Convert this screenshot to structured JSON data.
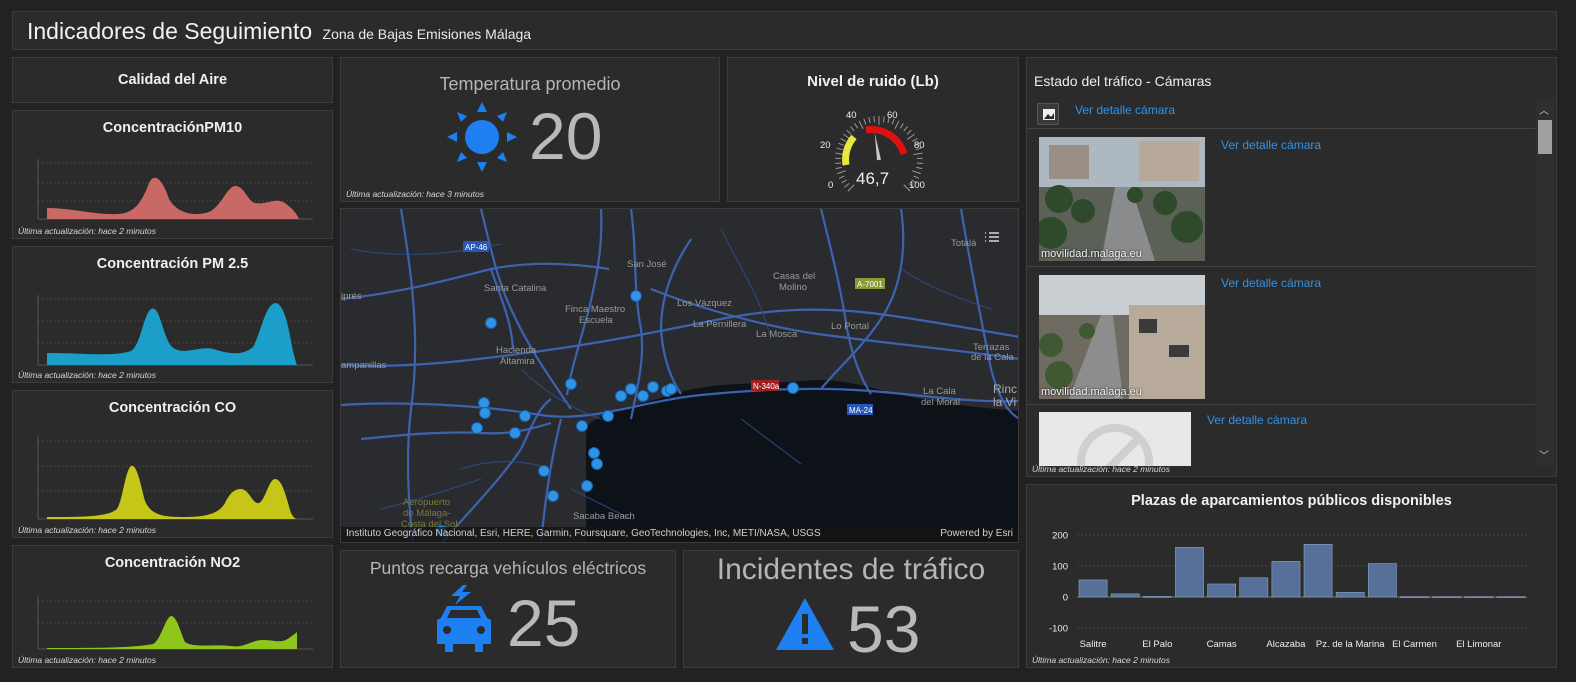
{
  "header": {
    "title": "Indicadores de Seguimiento",
    "subtitle": "Zona de Bajas Emisiones Málaga"
  },
  "air": {
    "title": "Calidad del Aire",
    "charts": [
      {
        "title": "ConcentraciónPM10",
        "updated": "Última actualización: hace 2 minutos",
        "color": "#c96966"
      },
      {
        "title": "Concentración PM 2.5",
        "updated": "Última actualización: hace 2 minutos",
        "color": "#1b9fc9"
      },
      {
        "title": "Concentración CO",
        "updated": "Última actualización: hace 2 minutos",
        "color": "#c6c618"
      },
      {
        "title": "Concentración NO2",
        "updated": "Última actualización: hace 2 minutos",
        "color": "#8ec61b"
      }
    ]
  },
  "temperature": {
    "title": "Temperatura promedio",
    "value": "20",
    "updated": "Última actualización: hace 3 minutos",
    "icon": "sun-icon"
  },
  "noise": {
    "title": "Nivel de ruido (Lb)",
    "value": "46,7",
    "reading": 46.7,
    "scale": [
      "0",
      "20",
      "40",
      "60",
      "80",
      "100"
    ]
  },
  "map": {
    "attribution": "Instituto Geográfico Nacional, Esri, HERE, Garmin, Foursquare, GeoTechnologies, Inc, METI/NASA, USGS",
    "powered": "Powered by Esri",
    "labels": {
      "ap46": "AP-46",
      "sanjose": "San José",
      "santacatalina": "Santa Catalina",
      "casas": "Casas del",
      "molino": "Molino",
      "a7001": "A-7001",
      "total": "Totalá",
      "finca": "Finca Maestro",
      "escuela": "Escuela",
      "vazquez": "Los Vázquez",
      "pernillera": "La Pernillera",
      "mosca": "La Mosca",
      "portal": "Lo Portal",
      "hacienda": "Hacienda",
      "altamira": "Altamira",
      "terrazas": "Terrazas",
      "cala": "de la Cala",
      "campanillas": "ampanillas",
      "ipres": "iprés",
      "n340": "N-340a",
      "caladel": "La Cala",
      "moral": "del Moral",
      "rinc": "Rinc",
      "lavi": "la Vi",
      "ma24": "MA-24",
      "aeropuerto": "Aeropuerto",
      "demalaga": "de Málaga-",
      "costa": "Costa del Sol",
      "sacaba": "Sacaba Beach"
    }
  },
  "charging": {
    "title": "Puntos recarga vehículos eléctricos",
    "value": "25",
    "icon": "electric-car-icon"
  },
  "incidents": {
    "title": "Incidentes de tráfico",
    "value": "53",
    "icon": "warning-icon"
  },
  "traffic": {
    "title": "Estado del tráfico - Cámaras",
    "link_label": "Ver detalle cámara",
    "items": [
      {
        "link": "Ver detalle cámara"
      },
      {
        "link": "Ver detalle cámara",
        "caption": "movilidad.malaga.eu"
      },
      {
        "link": "Ver detalle cámara",
        "caption": "movilidad.malaga.eu"
      },
      {
        "link": "Ver detalle cámara"
      }
    ],
    "updated": "Última actualización: hace 2 minutos"
  },
  "parking": {
    "title": "Plazas de aparcamientos públicos disponibles",
    "updated": "Última actualización: hace 2 minutos",
    "chart_data": {
      "type": "bar",
      "title": "Plazas de aparcamientos públicos disponibles",
      "ylim": [
        -100,
        200
      ],
      "yticks": [
        200,
        100,
        0,
        -100
      ],
      "xtick_labels": [
        "Salitre",
        "El Palo",
        "Camas",
        "Alcazaba",
        "Pz. de la Marina",
        "El Carmen",
        "El Limonar"
      ],
      "values": [
        55,
        10,
        2,
        160,
        42,
        62,
        115,
        170,
        15,
        108,
        1,
        1,
        1,
        1
      ],
      "color": "#56709a"
    }
  }
}
